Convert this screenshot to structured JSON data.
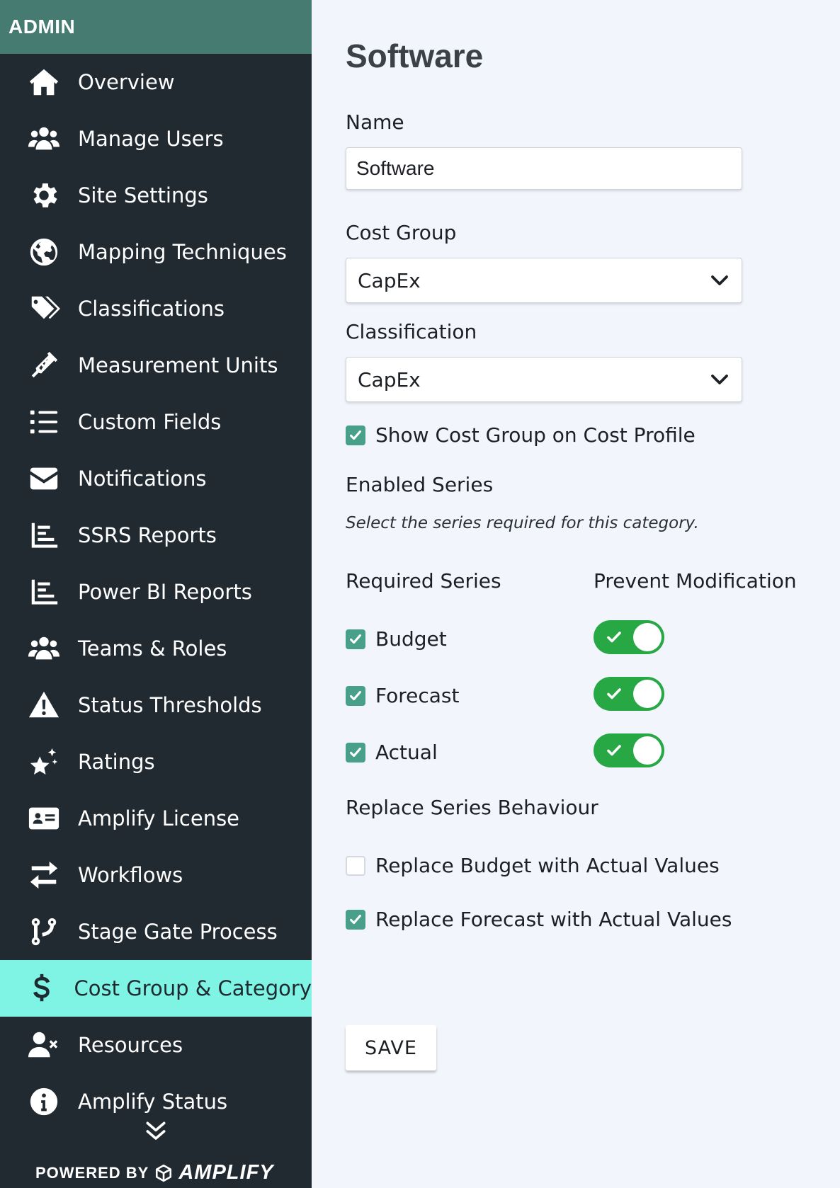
{
  "sidebar": {
    "header": "ADMIN",
    "items": [
      {
        "label": "Overview",
        "icon": "home-icon"
      },
      {
        "label": "Manage Users",
        "icon": "users-icon"
      },
      {
        "label": "Site Settings",
        "icon": "gear-icon"
      },
      {
        "label": "Mapping Techniques",
        "icon": "globe-icon"
      },
      {
        "label": "Classifications",
        "icon": "tags-icon"
      },
      {
        "label": "Measurement Units",
        "icon": "syringe-icon"
      },
      {
        "label": "Custom Fields",
        "icon": "list-icon"
      },
      {
        "label": "Notifications",
        "icon": "envelope-icon"
      },
      {
        "label": "SSRS Reports",
        "icon": "bar-chart-icon"
      },
      {
        "label": "Power BI Reports",
        "icon": "bar-chart-icon"
      },
      {
        "label": "Teams & Roles",
        "icon": "users-icon"
      },
      {
        "label": "Status Thresholds",
        "icon": "warning-icon"
      },
      {
        "label": "Ratings",
        "icon": "stars-icon"
      },
      {
        "label": "Amplify License",
        "icon": "id-card-icon"
      },
      {
        "label": "Workflows",
        "icon": "exchange-icon"
      },
      {
        "label": "Stage Gate Process",
        "icon": "branch-icon"
      },
      {
        "label": "Cost Group & Category",
        "icon": "dollar-icon",
        "active": true
      },
      {
        "label": "Resources",
        "icon": "user-x-icon"
      },
      {
        "label": "Amplify Status",
        "icon": "info-icon"
      }
    ],
    "footer": {
      "powered_by": "POWERED BY",
      "brand": "AMPLIFY"
    }
  },
  "form": {
    "title": "Software",
    "name_label": "Name",
    "name_value": "Software",
    "cost_group_label": "Cost Group",
    "cost_group_value": "CapEx",
    "classification_label": "Classification",
    "classification_value": "CapEx",
    "show_cost_group_label": "Show Cost Group on Cost Profile",
    "show_cost_group_checked": true,
    "enabled_series_heading": "Enabled Series",
    "enabled_series_help": "Select the series required for this category.",
    "required_series_header": "Required Series",
    "prevent_modification_header": "Prevent Modification",
    "series": [
      {
        "label": "Budget",
        "required": true,
        "prevent_modification": true
      },
      {
        "label": "Forecast",
        "required": true,
        "prevent_modification": true
      },
      {
        "label": "Actual",
        "required": true,
        "prevent_modification": true
      }
    ],
    "replace_heading": "Replace Series Behaviour",
    "replace_budget_label": "Replace Budget with Actual Values",
    "replace_budget_checked": false,
    "replace_forecast_label": "Replace Forecast with Actual Values",
    "replace_forecast_checked": true,
    "save_label": "SAVE"
  },
  "colors": {
    "sidebar_bg": "#222a31",
    "header_bg": "#467b72",
    "active_item_bg": "#7ff4e5",
    "checkbox_checked": "#49a08a",
    "toggle_on": "#28a745",
    "main_bg": "#f2f5fb"
  }
}
